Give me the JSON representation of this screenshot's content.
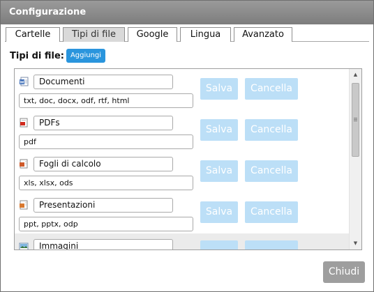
{
  "dialog": {
    "title": "Configurazione",
    "close_label": "Chiudi"
  },
  "tabs": [
    {
      "label": "Cartelle",
      "active": false
    },
    {
      "label": "Tipi di file",
      "active": true
    },
    {
      "label": "Google",
      "active": false
    },
    {
      "label": "Lingua",
      "active": false
    },
    {
      "label": "Avanzato",
      "active": false
    }
  ],
  "filetypes": {
    "section_label": "Tipi di file:",
    "add_label": "Aggiungi",
    "save_label": "Salva",
    "cancel_label": "Cancella",
    "rows": [
      {
        "name": "Documenti",
        "extensions": "txt, doc, docx, odf, rtf, html",
        "icon": "word-document-icon"
      },
      {
        "name": "PDFs",
        "extensions": "pdf",
        "icon": "pdf-document-icon"
      },
      {
        "name": "Fogli di calcolo",
        "extensions": "xls, xlsx, ods",
        "icon": "spreadsheet-document-icon"
      },
      {
        "name": "Presentazioni",
        "extensions": "ppt, pptx, odp",
        "icon": "presentation-document-icon"
      },
      {
        "name": "Immagini",
        "extensions": "",
        "icon": "image-document-icon"
      }
    ]
  },
  "colors": {
    "titlebar": "#8a8a8a",
    "add_button": "#2a95dd",
    "disabled_button": "#bcdff7",
    "close_button": "#9e9e9e"
  }
}
